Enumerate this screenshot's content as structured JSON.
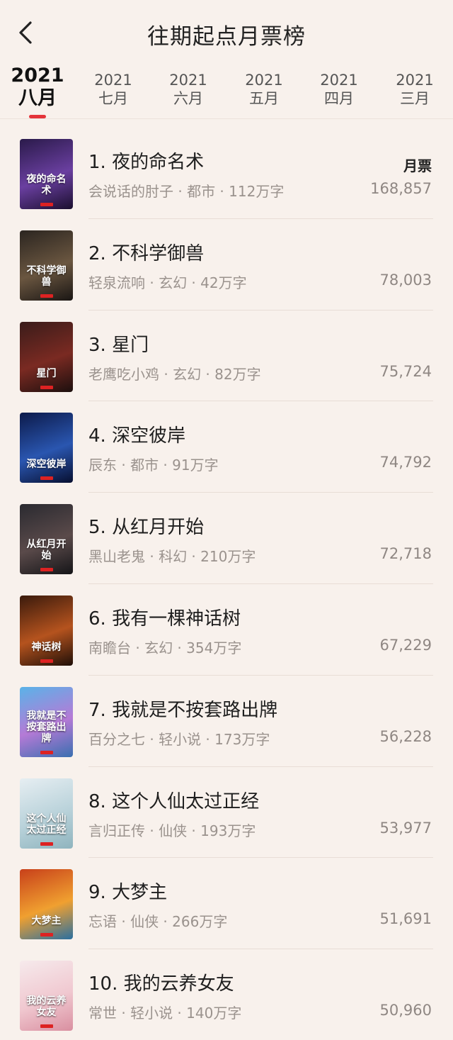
{
  "header": {
    "title": "往期起点月票榜",
    "back_icon": "chevron-left-icon"
  },
  "tabs": [
    {
      "year": "2021",
      "month": "八月",
      "active": true
    },
    {
      "year": "2021",
      "month": "七月",
      "active": false
    },
    {
      "year": "2021",
      "month": "六月",
      "active": false
    },
    {
      "year": "2021",
      "month": "五月",
      "active": false
    },
    {
      "year": "2021",
      "month": "四月",
      "active": false
    },
    {
      "year": "2021",
      "month": "三月",
      "active": false
    }
  ],
  "votes_label": "月票",
  "accent_color": "#e4343a",
  "books": [
    {
      "rank": "1.",
      "name": "夜的命名术",
      "author": "会说话的肘子",
      "genre": "都市",
      "words": "112万字",
      "votes": "168,857",
      "cover_text": "夜的命名术",
      "cover_colors": [
        "#2a1a4a",
        "#6a3fa0",
        "#1b0f2f"
      ]
    },
    {
      "rank": "2.",
      "name": "不科学御兽",
      "author": "轻泉流响",
      "genre": "玄幻",
      "words": "42万字",
      "votes": "78,003",
      "cover_text": "不科学御兽",
      "cover_colors": [
        "#2b2520",
        "#6a5640",
        "#1a1614"
      ]
    },
    {
      "rank": "3.",
      "name": "星门",
      "author": "老鹰吃小鸡",
      "genre": "玄幻",
      "words": "82万字",
      "votes": "75,724",
      "cover_text": "星门",
      "cover_colors": [
        "#3a1c1a",
        "#7a2a22",
        "#1c0f0e"
      ]
    },
    {
      "rank": "4.",
      "name": "深空彼岸",
      "author": "辰东",
      "genre": "都市",
      "words": "91万字",
      "votes": "74,792",
      "cover_text": "深空彼岸",
      "cover_colors": [
        "#0c1a4a",
        "#2a56b0",
        "#070f30"
      ]
    },
    {
      "rank": "5.",
      "name": "从红月开始",
      "author": "黑山老鬼",
      "genre": "科幻",
      "words": "210万字",
      "votes": "72,718",
      "cover_text": "从红月开始",
      "cover_colors": [
        "#2a2a30",
        "#5a4a4a",
        "#151518"
      ]
    },
    {
      "rank": "6.",
      "name": "我有一棵神话树",
      "author": "南瞻台",
      "genre": "玄幻",
      "words": "354万字",
      "votes": "67,229",
      "cover_text": "神话树",
      "cover_colors": [
        "#3a1a0c",
        "#b5531e",
        "#1f0f08"
      ]
    },
    {
      "rank": "7.",
      "name": "我就是不按套路出牌",
      "author": "百分之七",
      "genre": "轻小说",
      "words": "173万字",
      "votes": "56,228",
      "cover_text": "我就是不按套路出牌",
      "cover_colors": [
        "#5ab3e8",
        "#b57ad6",
        "#3a6fb0"
      ]
    },
    {
      "rank": "8.",
      "name": "这个人仙太过正经",
      "author": "言归正传",
      "genre": "仙侠",
      "words": "193万字",
      "votes": "53,977",
      "cover_text": "这个人仙太过正经",
      "cover_colors": [
        "#e6eef2",
        "#b9d2da",
        "#8fb4be"
      ]
    },
    {
      "rank": "9.",
      "name": "大梦主",
      "author": "忘语",
      "genre": "仙侠",
      "words": "266万字",
      "votes": "51,691",
      "cover_text": "大梦主",
      "cover_colors": [
        "#c8401a",
        "#f0a030",
        "#2a6fa0"
      ]
    },
    {
      "rank": "10.",
      "name": "我的云养女友",
      "author": "常世",
      "genre": "轻小说",
      "words": "140万字",
      "votes": "50,960",
      "cover_text": "我的云养女友",
      "cover_colors": [
        "#f6eaec",
        "#f0c8d0",
        "#d98fa0"
      ]
    }
  ]
}
